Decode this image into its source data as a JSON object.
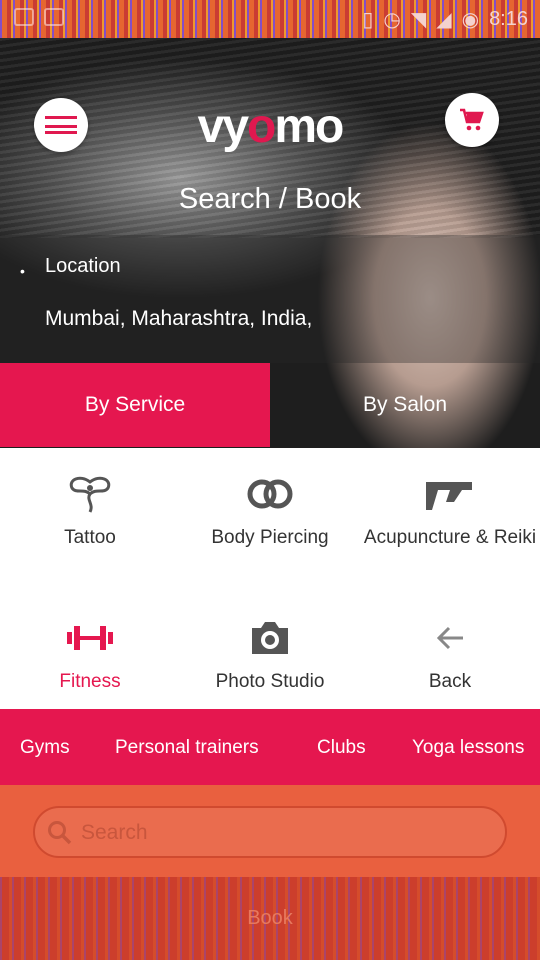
{
  "status_bar": {
    "time": "8:16"
  },
  "header": {
    "logo_text_a": "vy",
    "logo_text_o": "o",
    "logo_text_b": "mo",
    "title": "Search / Book"
  },
  "location": {
    "label": "Location",
    "value": "Mumbai, Maharashtra, India,"
  },
  "tabs": {
    "by_service": "By Service",
    "by_salon": "By Salon"
  },
  "services": [
    {
      "label": "Tattoo",
      "icon": "tattoo-icon"
    },
    {
      "label": "Body Piercing",
      "icon": "rings-icon"
    },
    {
      "label": "Acupuncture & Reiki",
      "icon": "hand-icon"
    },
    {
      "label": "Fitness",
      "icon": "dumbbell-icon"
    },
    {
      "label": "Photo Studio",
      "icon": "camera-icon"
    },
    {
      "label": "Back",
      "icon": "back-arrow-icon"
    }
  ],
  "subcategories": [
    "Gyms",
    "Personal trainers",
    "Clubs",
    "Yoga lessons"
  ],
  "search": {
    "placeholder": "Search"
  },
  "book": {
    "label": "Book"
  },
  "colors": {
    "accent": "#e5174f",
    "search_bg": "#e9603f",
    "book_bg": "#cc3e2c"
  }
}
